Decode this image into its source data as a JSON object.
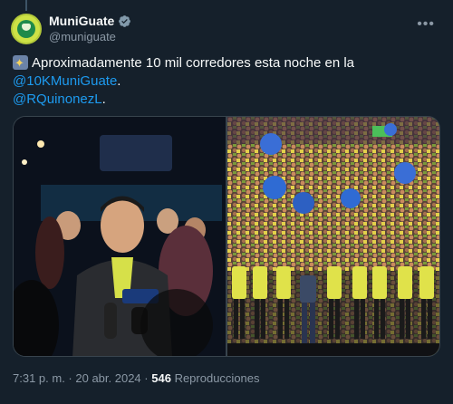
{
  "account": {
    "display_name": "MuniGuate",
    "handle": "@muniguate"
  },
  "tweet": {
    "text_main": "Aproximadamente 10 mil corredores esta noche en la",
    "mention_1": "@10KMuniGuate",
    "mention_1_suffix": ".",
    "mention_2": "@RQuinonezL",
    "mention_2_suffix": "."
  },
  "media": {
    "photos": [
      "photo-left",
      "photo-right"
    ]
  },
  "footer": {
    "time": "7:31 p. m.",
    "separator_1": " · ",
    "date": "20 abr. 2024",
    "separator_2": " · ",
    "views_count": "546",
    "views_label": "Reproducciones"
  },
  "icons": {
    "verified": "verified-badge-icon",
    "more": "more-options-icon",
    "emoji": "sparkle-emoji-icon"
  },
  "colors": {
    "background": "#15202b",
    "text": "#f7f9f9",
    "secondary": "#8b98a5",
    "link": "#1d9bf0",
    "border": "#38444d"
  }
}
